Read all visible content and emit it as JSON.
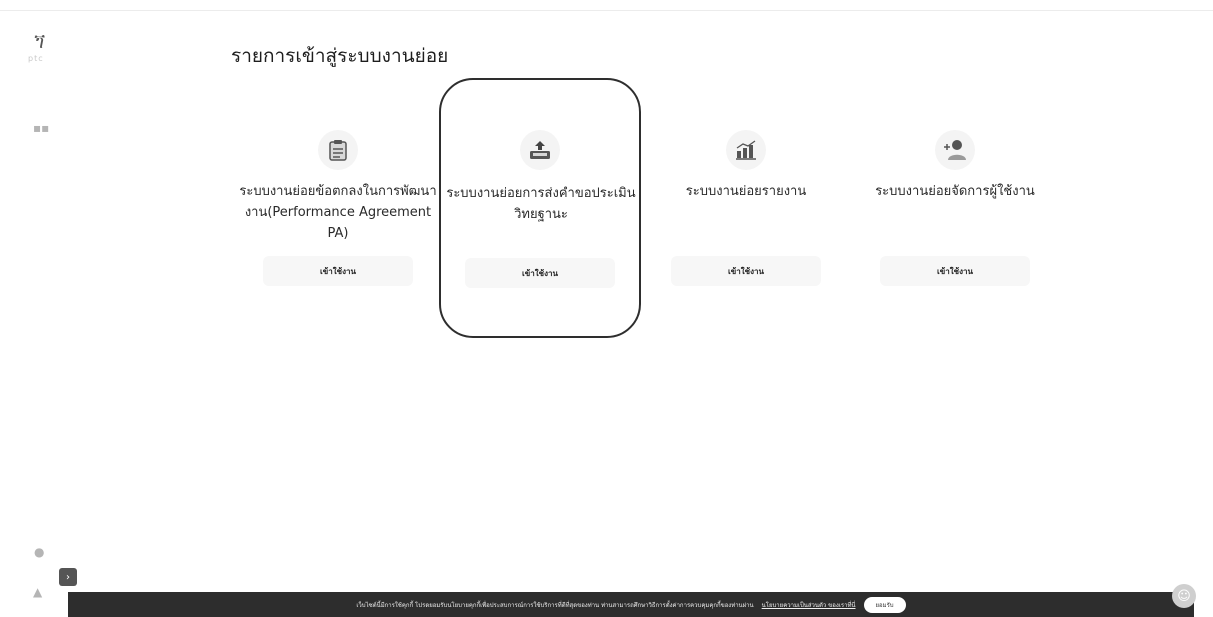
{
  "page": {
    "title": "รายการเข้าสู่ระบบงานย่อย"
  },
  "rail": {
    "logo_text": "ptc"
  },
  "cards": [
    {
      "title": "ระบบงานย่อยข้อตกลงในการพัฒนางาน(Performance Agreement PA)",
      "enter_label": "เข้าใช้งาน",
      "icon": "clipboard-icon"
    },
    {
      "title": "ระบบงานย่อยการส่งคำขอประเมินวิทยฐานะ",
      "enter_label": "เข้าใช้งาน",
      "icon": "upload-tray-icon"
    },
    {
      "title": "ระบบงานย่อยรายงาน",
      "enter_label": "เข้าใช้งาน",
      "icon": "bar-chart-icon"
    },
    {
      "title": "ระบบงานย่อยจัดการผู้ใช้งาน",
      "enter_label": "เข้าใช้งาน",
      "icon": "add-user-icon"
    }
  ],
  "cookie": {
    "message": "เว็บไซต์นี้มีการใช้คุกกี้ โปรดยอมรับนโยบายคุกกี้เพื่อประสบการณ์การใช้บริการที่ดีที่สุดของท่าน ท่านสามารถศึกษาวิธีการตั้งค่าการควบคุมคุกกี้ของท่านผ่าน",
    "link": "นโยบายความเป็นส่วนตัว ของเราที่นี่",
    "button": "ยอมรับ"
  },
  "colors": {
    "cookie_bar": "#2d2d2d",
    "selected_border": "#2e2e2e"
  }
}
